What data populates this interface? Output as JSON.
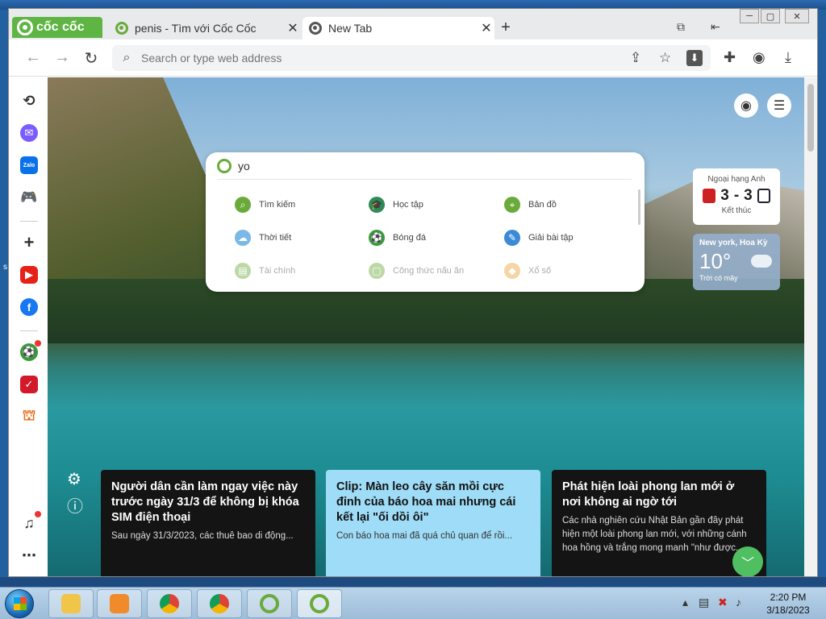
{
  "desktop": {
    "edge_text": "s"
  },
  "tabs": [
    {
      "title": "penis - Tìm với Cốc Cốc",
      "close": "✕"
    },
    {
      "title": "New Tab",
      "close": "✕"
    }
  ],
  "brand": {
    "name": "cốc cốc"
  },
  "new_tab_label": "+",
  "window_controls": [
    "─",
    "▢",
    "✕"
  ],
  "omnibox": {
    "placeholder": "Search or type web address",
    "value": ""
  },
  "search_panel": {
    "query": "yo",
    "categories": [
      {
        "label": "Tìm kiếm",
        "icon": "search-icon",
        "color": "#6aaa3b"
      },
      {
        "label": "Học tập",
        "icon": "graduation-cap-icon",
        "color": "#2e8b57"
      },
      {
        "label": "Bản đồ",
        "icon": "map-pin-icon",
        "color": "#6aaa3b"
      },
      {
        "label": "Thời tiết",
        "icon": "weather-icon",
        "color": "#7ab8e6"
      },
      {
        "label": "Bóng đá",
        "icon": "football-icon",
        "color": "#3a9a3a"
      },
      {
        "label": "Giải bài tập",
        "icon": "homework-icon",
        "color": "#3a8ad6"
      },
      {
        "label": "Tài chính",
        "icon": "finance-icon",
        "color": "#6aaa3b"
      },
      {
        "label": "Công thức nấu ăn",
        "icon": "recipe-icon",
        "color": "#6aaa3b"
      },
      {
        "label": "Xổ số",
        "icon": "lottery-icon",
        "color": "#e8a63a"
      }
    ]
  },
  "score_widget": {
    "league": "Ngoại hạng Anh",
    "home": "3",
    "sep": "-",
    "away": "3",
    "status": "Kết thúc"
  },
  "weather_widget": {
    "city": "New york, Hoa Kỳ",
    "temp": "10°",
    "desc": "Trời có mây"
  },
  "news": [
    {
      "title": "Người dân cần làm ngay việc này trước ngày 31/3 để không bị khóa SIM điện thoại",
      "desc": "Sau ngày 31/3/2023, các thuê bao di động..."
    },
    {
      "title": "Clip: Màn leo cây săn mồi cực đỉnh của báo hoa mai nhưng cái kết lại \"ối dồi ôi\"",
      "desc": "Con báo hoa mai đã quá chủ quan để rồi..."
    },
    {
      "title": "Phát hiện loài phong lan mới ở nơi không ai ngờ tới",
      "desc": "Các nhà nghiên cứu Nhật Bản gần đây phát hiện một loài phong lan mới, với những cánh hoa hồng và trắng mong manh \"như được..."
    }
  ],
  "sidebar_badges": {
    "zalo": "Zalo"
  },
  "clock": {
    "time": "2:20 PM",
    "date": "3/18/2023"
  },
  "colors": {
    "brand": "#5fb544",
    "fab": "#4fbf62",
    "news_light": "#9fdcf7"
  }
}
